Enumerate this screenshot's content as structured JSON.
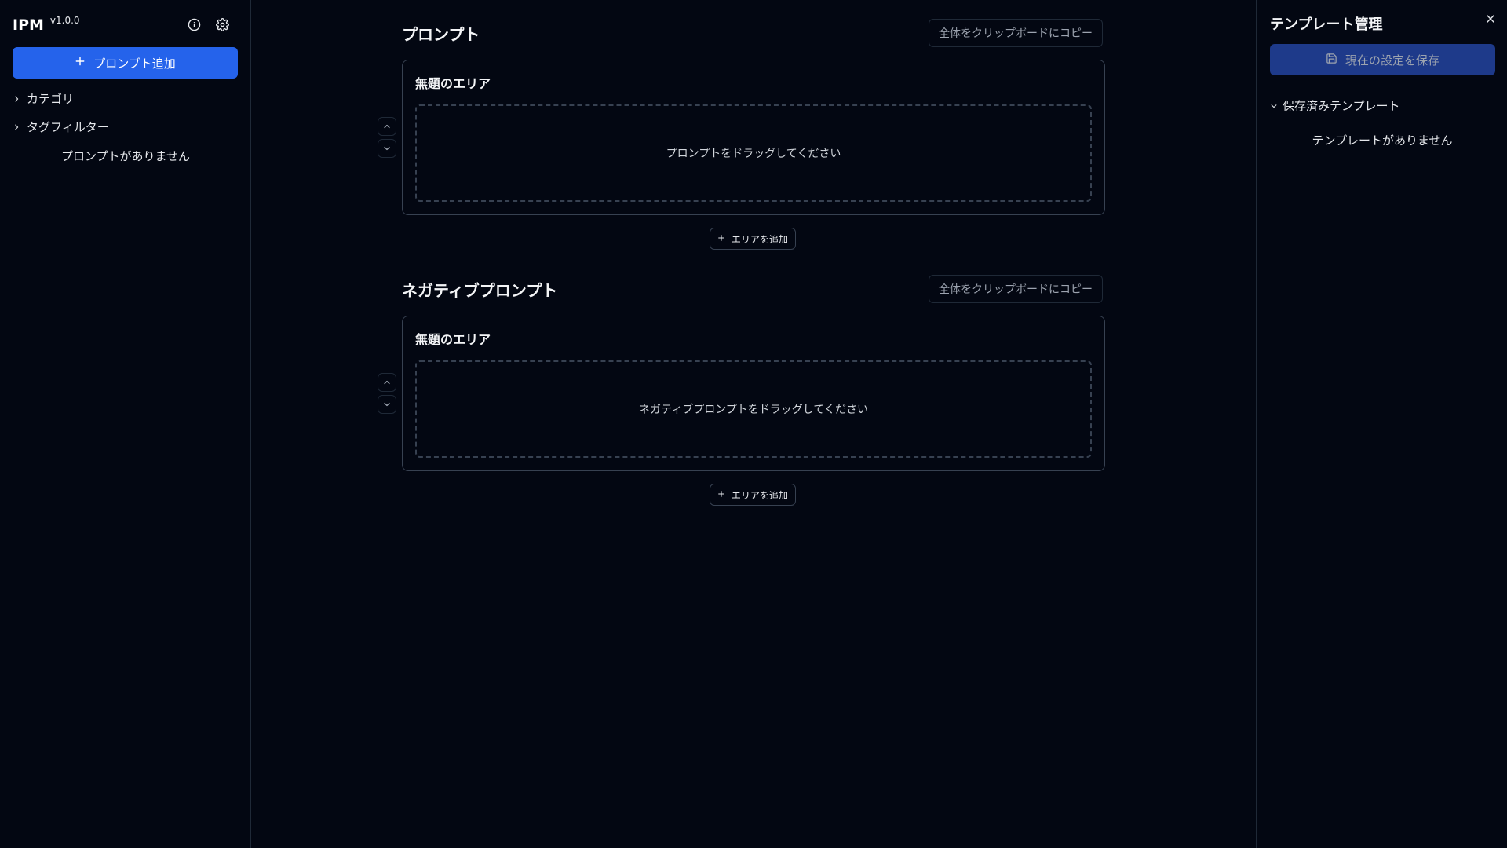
{
  "sidebar": {
    "app_name": "IPM",
    "version": "v1.0.0",
    "add_prompt_label": "プロンプト追加",
    "sections": [
      {
        "label": "カテゴリ"
      },
      {
        "label": "タグフィルター"
      }
    ],
    "empty_text": "プロンプトがありません"
  },
  "main": {
    "prompt": {
      "title": "プロンプト",
      "copy_label": "全体をクリップボードにコピー",
      "area_title": "無題のエリア",
      "drop_text": "プロンプトをドラッグしてください",
      "add_area_label": "エリアを追加"
    },
    "negative": {
      "title": "ネガティブプロンプト",
      "copy_label": "全体をクリップボードにコピー",
      "area_title": "無題のエリア",
      "drop_text": "ネガティブプロンプトをドラッグしてください",
      "add_area_label": "エリアを追加"
    }
  },
  "right_panel": {
    "title": "テンプレート管理",
    "save_label": "現在の設定を保存",
    "section_label": "保存済みテンプレート",
    "empty_text": "テンプレートがありません"
  },
  "colors": {
    "background": "#030712",
    "accent": "#2563eb",
    "accent_disabled": "#1e3a8a",
    "border": "#374151"
  }
}
